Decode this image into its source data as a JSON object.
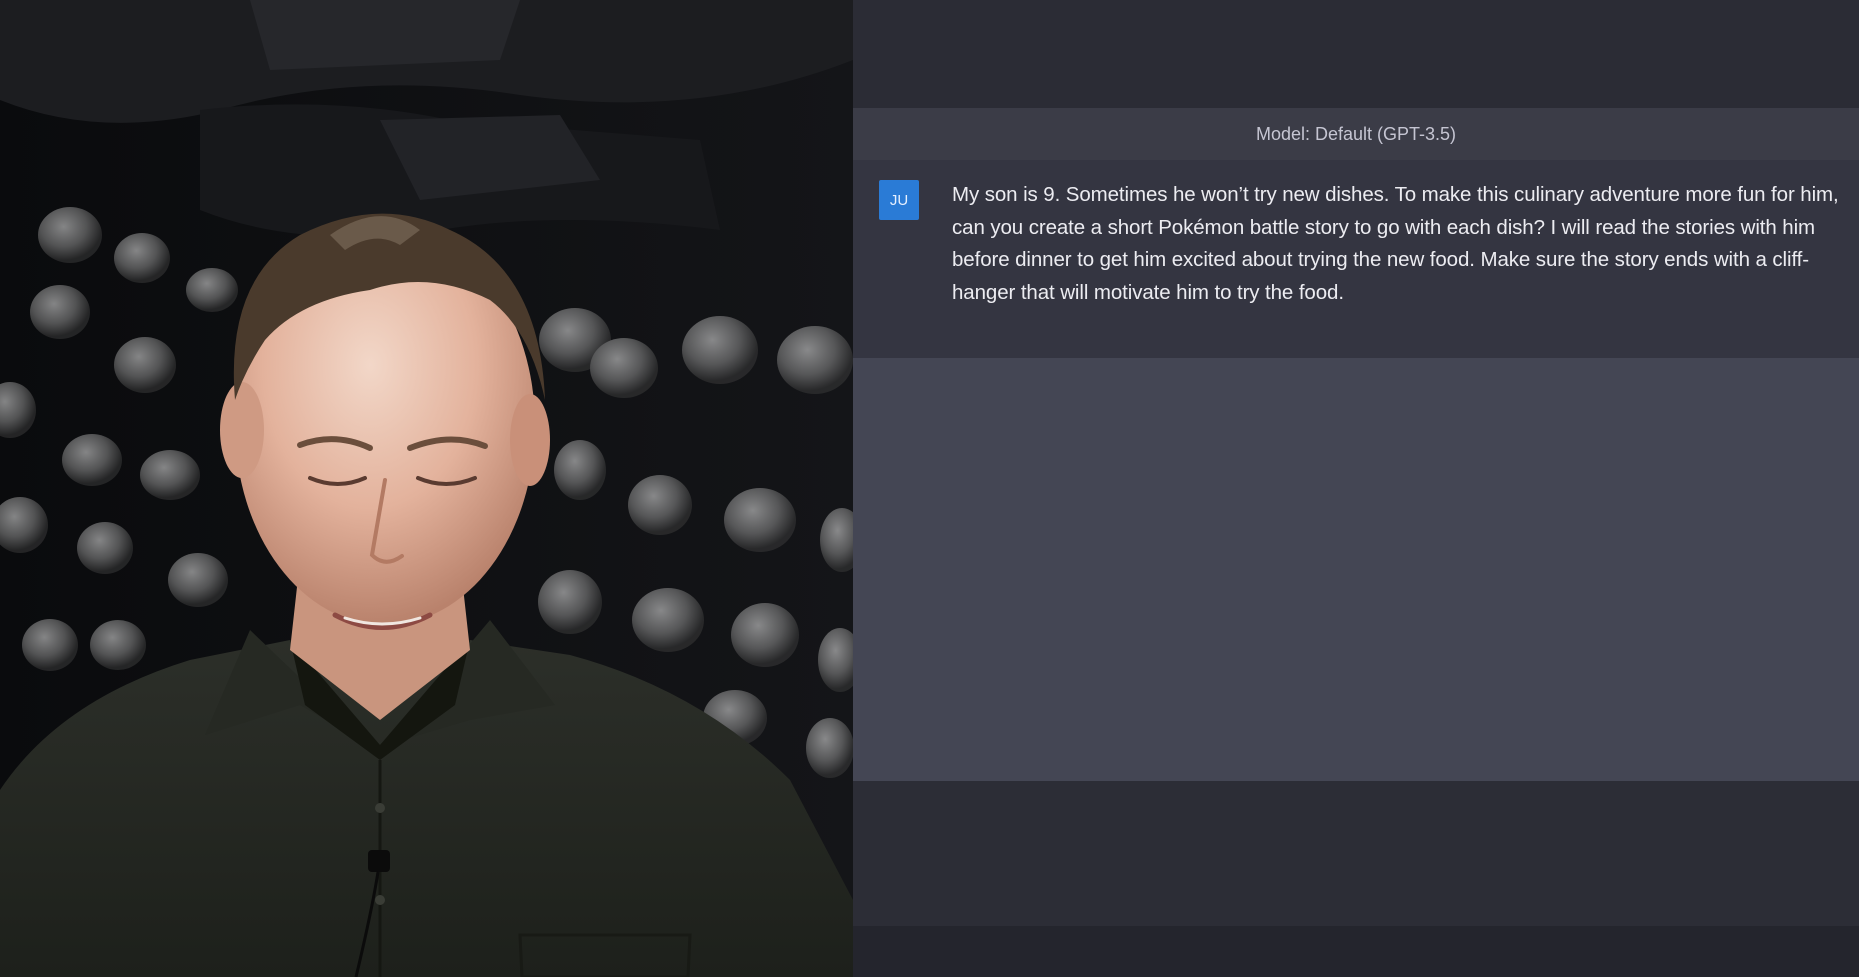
{
  "chat": {
    "model_label": "Model: Default (GPT-3.5)",
    "messages": [
      {
        "role": "user",
        "avatar_initials": "JU",
        "text": "My son is 9. Sometimes he won’t try new dishes. To make this culinary adventure more fun for him, can you create a short Pokémon battle story to go with each dish? I will read the stories with him before dinner to get him excited about trying the new food. Make sure the story ends with a cliff-hanger that will motivate him to try the food."
      }
    ]
  },
  "colors": {
    "avatar": "#2a7bd6",
    "chat_background": "#343541",
    "response_background": "#444654",
    "model_bar": "#3b3c47"
  },
  "icons": {
    "webcam": "presenter-video-feed"
  }
}
